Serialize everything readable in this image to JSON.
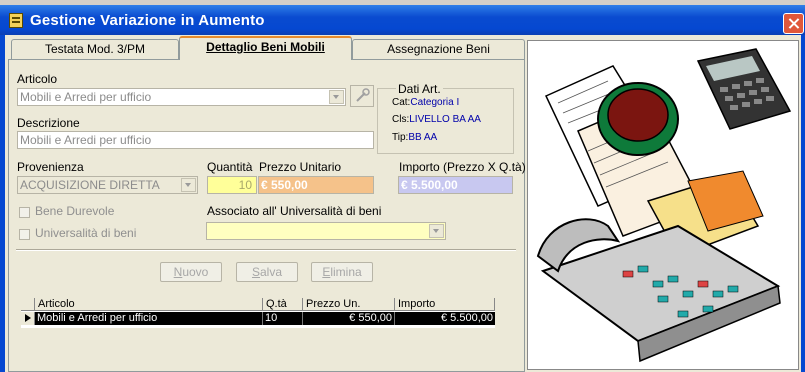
{
  "window": {
    "title": "Gestione Variazione in Aumento",
    "close_icon": "close-icon",
    "app_icon": "form-icon"
  },
  "tabs": [
    {
      "label": "Testata Mod. 3/PM",
      "active": false
    },
    {
      "label": "Dettaglio Beni Mobili",
      "active": true
    },
    {
      "label": "Assegnazione Beni",
      "active": false
    }
  ],
  "form": {
    "articolo_label": "Articolo",
    "articolo_value": "Mobili e Arredi per ufficio",
    "descrizione_label": "Descrizione",
    "descrizione_value": "Mobili e Arredi per ufficio",
    "provenienza_label": "Provenienza",
    "provenienza_value": "ACQUISIZIONE DIRETTA",
    "quantita_label": "Quantità",
    "quantita_value": "10",
    "prezzo_label": "Prezzo Unitario",
    "prezzo_value": "€ 550,00",
    "importo_label": "Importo (Prezzo X Q.tà)",
    "importo_value": "€ 5.500,00",
    "bene_durevole_label": "Bene Durevole",
    "universalita_label": "Universalità di beni",
    "associato_label": "Associato all' Universalità di beni",
    "associato_value": ""
  },
  "dati_art": {
    "title": "Dati Art.",
    "cat_label": "Cat:",
    "cat_value": "Categoria I",
    "cls_label": "Cls:",
    "cls_value": "LIVELLO BA AA",
    "tip_label": "Tip:",
    "tip_value": "BB AA"
  },
  "buttons": {
    "nuovo_first": "N",
    "nuovo_rest": "uovo",
    "salva_first": "S",
    "salva_rest": "alva",
    "elimina_first": "E",
    "elimina_rest": "limina"
  },
  "grid": {
    "columns": [
      "Articolo",
      "Q.tà",
      "Prezzo Un.",
      "Importo"
    ],
    "rows": [
      {
        "articolo": "Mobili e Arredi per ufficio",
        "qta": "10",
        "prezzo": "€ 550,00",
        "importo": "€ 5.500,00"
      }
    ]
  },
  "colors": {
    "titlebar": "#0548d1",
    "quantita_bg": "#ffff99",
    "prezzo_bg": "#f5c28a",
    "importo_bg": "#c8c8f0",
    "associato_bg": "#ffffc0",
    "info_text": "#0000aa"
  }
}
